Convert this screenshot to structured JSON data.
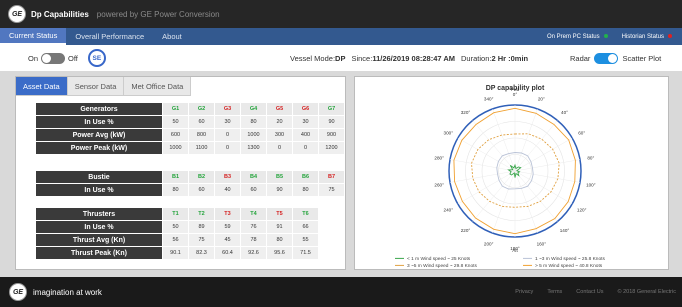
{
  "header": {
    "logo": "GE",
    "title": "Dp Capabilities",
    "subtitle": "powered by GE Power Conversion"
  },
  "nav": {
    "tabs": [
      {
        "label": "Current Status"
      },
      {
        "label": "Overall Performance"
      },
      {
        "label": "About"
      }
    ],
    "onprem_label": "On Prem PC Status",
    "historian_label": "Historian Status",
    "onprem_color": "#22b14c",
    "historian_color": "#e02020"
  },
  "controls": {
    "on_label": "On",
    "off_label": "Off",
    "se_badge": "SE",
    "vessel_mode_label": "Vessel Mode:",
    "vessel_mode_value": "DP",
    "since_label": "Since:",
    "since_value": "11/26/2019 08:28:47 AM",
    "duration_label": "Duration:",
    "duration_value": "2 Hr :0min",
    "radar_label": "Radar",
    "scatter_label": "Scatter Plot"
  },
  "subtabs": [
    {
      "label": "Asset Data"
    },
    {
      "label": "Sensor Data"
    },
    {
      "label": "Met Office Data"
    }
  ],
  "generators": {
    "header": "Generators",
    "cols": [
      {
        "label": "G1",
        "color": "#22a33a"
      },
      {
        "label": "G2",
        "color": "#22a33a"
      },
      {
        "label": "G3",
        "color": "#d42020"
      },
      {
        "label": "G4",
        "color": "#22a33a"
      },
      {
        "label": "G5",
        "color": "#d42020"
      },
      {
        "label": "G6",
        "color": "#d42020"
      },
      {
        "label": "G7",
        "color": "#22a33a"
      }
    ],
    "rows": [
      {
        "label": "In Use %",
        "values": [
          "50",
          "60",
          "30",
          "80",
          "20",
          "30",
          "90"
        ]
      },
      {
        "label": "Power Avg (kW)",
        "values": [
          "600",
          "800",
          "0",
          "1000",
          "300",
          "400",
          "900"
        ]
      },
      {
        "label": "Power Peak (kW)",
        "values": [
          "1000",
          "1100",
          "0",
          "1300",
          "0",
          "0",
          "1200"
        ]
      }
    ]
  },
  "bustie": {
    "header": "Bustie",
    "cols": [
      {
        "label": "B1",
        "color": "#22a33a"
      },
      {
        "label": "B2",
        "color": "#22a33a"
      },
      {
        "label": "B3",
        "color": "#d42020"
      },
      {
        "label": "B4",
        "color": "#22a33a"
      },
      {
        "label": "B5",
        "color": "#22a33a"
      },
      {
        "label": "B6",
        "color": "#22a33a"
      },
      {
        "label": "B7",
        "color": "#d42020"
      }
    ],
    "rows": [
      {
        "label": "In Use %",
        "values": [
          "80",
          "60",
          "40",
          "60",
          "90",
          "80",
          "75"
        ]
      }
    ]
  },
  "thrusters": {
    "header": "Thrusters",
    "cols": [
      {
        "label": "T1",
        "color": "#22a33a"
      },
      {
        "label": "T2",
        "color": "#22a33a"
      },
      {
        "label": "T3",
        "color": "#d42020"
      },
      {
        "label": "T4",
        "color": "#22a33a"
      },
      {
        "label": "T5",
        "color": "#d42020"
      },
      {
        "label": "T6",
        "color": "#22a33a"
      }
    ],
    "rows": [
      {
        "label": "In Use %",
        "values": [
          "50",
          "89",
          "59",
          "76",
          "91",
          "66"
        ]
      },
      {
        "label": "Thrust Avg (Kn)",
        "values": [
          "56",
          "75",
          "45",
          "78",
          "80",
          "55"
        ]
      },
      {
        "label": "Thrust Peak (Kn)",
        "values": [
          "90.1",
          "82.3",
          "60.4",
          "92.6",
          "95.6",
          "71.5"
        ]
      }
    ]
  },
  "chart_data": {
    "type": "radar",
    "title": "DP capability plot",
    "fwd_label": "Fwd",
    "aft_label": "Aft",
    "angles": [
      "0°",
      "20°",
      "40°",
      "60°",
      "80°",
      "100°",
      "120°",
      "140°",
      "160°",
      "180°",
      "200°",
      "220°",
      "240°",
      "260°",
      "280°",
      "300°",
      "320°",
      "340°"
    ],
    "series": [
      {
        "name": "< 1 m Wind speed ~ 25 Knots",
        "color": "#3aa64c",
        "style": "spiky",
        "values": [
          0.09,
          0.04,
          0.08,
          0.1,
          0.03,
          0.07,
          0.05,
          0.09,
          0.04,
          0.1,
          0.03,
          0.08,
          0.09,
          0.06,
          0.1,
          0.04,
          0.11,
          0.05
        ]
      },
      {
        "name": "1 ~3 m Wind speed ~ 25.8 Knots",
        "color": "#b9c2d6",
        "style": "smooth",
        "values": [
          0.28,
          0.29,
          0.3,
          0.28,
          0.27,
          0.28,
          0.29,
          0.3,
          0.28,
          0.27,
          0.29,
          0.3,
          0.28,
          0.27,
          0.28,
          0.29,
          0.3,
          0.28
        ]
      },
      {
        "name": "3 ~5 m Wind speed ~ 29.8 Knots",
        "color": "#e0a040",
        "style": "dashed",
        "values": [
          0.56,
          0.6,
          0.63,
          0.66,
          0.68,
          0.66,
          0.63,
          0.6,
          0.57,
          0.55,
          0.57,
          0.6,
          0.63,
          0.65,
          0.67,
          0.65,
          0.62,
          0.58
        ]
      },
      {
        "name": "> 5 m Wind speed ~ 40.8 Knots",
        "color": "#f0a030",
        "style": "solid",
        "values": [
          0.95,
          0.93,
          0.92,
          0.94,
          0.93,
          0.92,
          0.93,
          0.94,
          0.93,
          0.95,
          0.94,
          0.93,
          0.92,
          0.93,
          0.94,
          0.93,
          0.92,
          0.94
        ]
      }
    ],
    "outer_ring_color": "#2f5fb8"
  },
  "footer": {
    "logo": "GE",
    "tagline": "imagination at work",
    "links": [
      "Privacy",
      "Terms",
      "Contact Us",
      "© 2018 General Electric"
    ]
  }
}
